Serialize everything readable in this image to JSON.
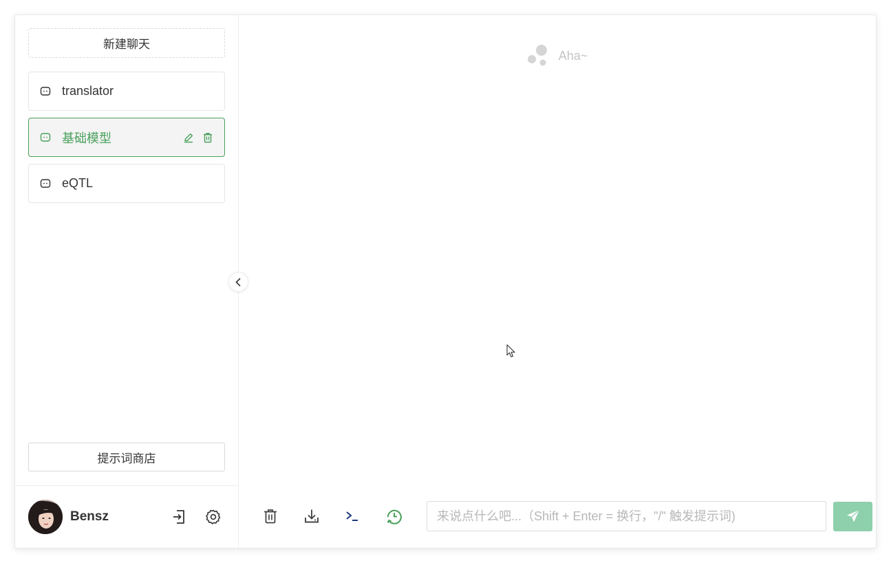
{
  "sidebar": {
    "new_chat_label": "新建聊天",
    "chats": [
      {
        "label": "translator",
        "active": false
      },
      {
        "label": "基础模型",
        "active": true
      },
      {
        "label": "eQTL",
        "active": false
      }
    ],
    "store_label": "提示词商店",
    "user": {
      "name": "Bensz"
    }
  },
  "main": {
    "empty_text": "Aha~",
    "input": {
      "placeholder": "来说点什么吧...（Shift + Enter = 换行，\"/\" 触发提示词)",
      "value": ""
    }
  },
  "colors": {
    "accent": "#48a05b",
    "send_button": "#8ed0ab",
    "hint_gray": "#c4c4c4"
  },
  "icons": {
    "chat_item": "message-bot-icon",
    "edit": "pencil-icon",
    "delete": "trash-icon",
    "logout": "logout-icon",
    "settings": "gear-icon",
    "collapse": "chevron-left-icon",
    "clear": "trash-icon",
    "download": "download-icon",
    "prompt": "terminal-icon",
    "history": "history-icon",
    "send": "send-icon"
  }
}
